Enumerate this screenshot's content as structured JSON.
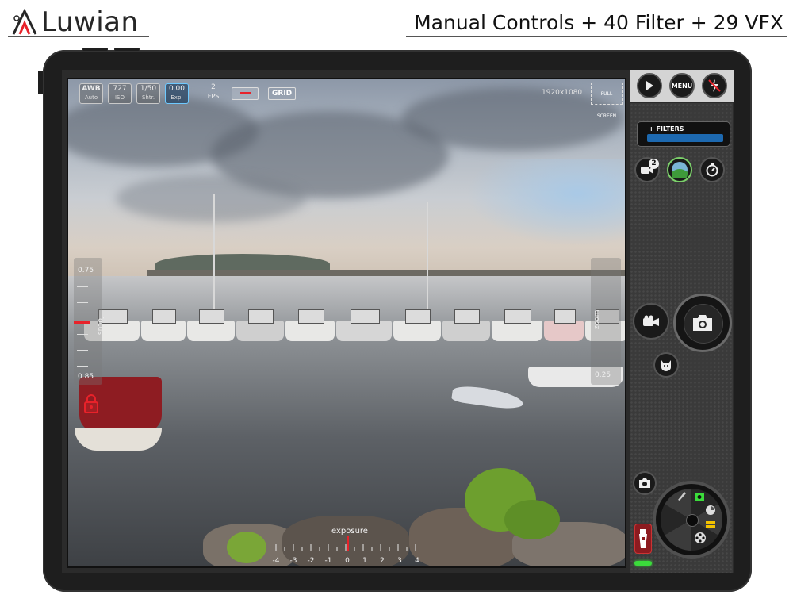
{
  "header": {
    "logo_text": "Luwian",
    "tagline": "Manual Controls + 40 Filter + 29 VFX"
  },
  "top_controls": {
    "awb": {
      "value": "AWB",
      "label": "Auto"
    },
    "iso": {
      "value": "727",
      "label": "ISO"
    },
    "shutter": {
      "value": "1/50",
      "label": "Shtr."
    },
    "exposure": {
      "value": "0.00",
      "label": "Exp."
    },
    "fps": {
      "value": "2",
      "label": "FPS"
    },
    "grid_label": "GRID",
    "resolution": "1920x1080",
    "fullscreen_label": "FULL SCREEN"
  },
  "focus": {
    "label": "focus",
    "top_value": "0.75",
    "bottom_value": "0.85"
  },
  "zoom": {
    "label": "zoom",
    "value": "0.25"
  },
  "exposure_scale": {
    "label": "exposure",
    "ticks": [
      "-4",
      "-3",
      "-2",
      "-1",
      "0",
      "1",
      "2",
      "3",
      "4"
    ],
    "current": 0
  },
  "right_panel": {
    "menu_label": "MENU",
    "filters_label": "+ FILTERS",
    "camera_badge": "2"
  },
  "colors": {
    "accent_red": "#e8222a",
    "accent_blue": "#1d69b0",
    "led_green": "#3bdc3b"
  },
  "icons": {
    "logo": "luwian-logo-icon",
    "play": "play-icon",
    "flash_off": "flash-off-icon",
    "timer": "timer-icon",
    "video": "video-camera-icon",
    "camera": "camera-icon",
    "cat": "cat-icon",
    "switch_camera": "switch-camera-icon",
    "lock": "lock-icon",
    "torch": "torch-icon"
  }
}
